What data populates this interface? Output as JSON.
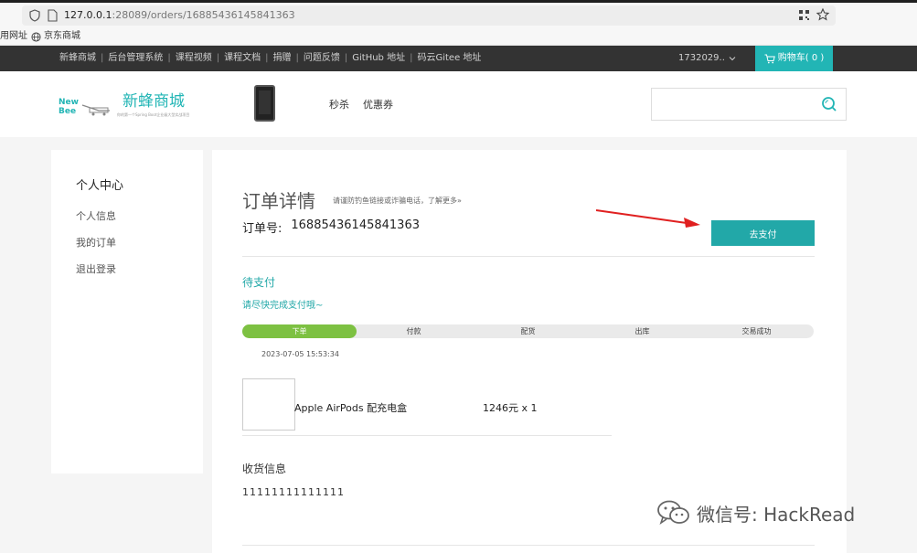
{
  "browser": {
    "url_host": "127.0.0.1",
    "url_rest": ":28089/orders/16885436145841363",
    "bookmarks": [
      "用网址",
      "京东商城"
    ]
  },
  "topnav": {
    "links": [
      "新蜂商城",
      "后台管理系统",
      "课程视频",
      "课程文档",
      "捐赠",
      "问题反馈",
      "GitHub 地址",
      "码云Gitee 地址"
    ],
    "user": "1732029..",
    "cart_label": "购物车( 0 )"
  },
  "header": {
    "logo_text": "New Bee",
    "site_name": "新蜂商城",
    "slogan": "你的第一个Spring Boot企业级大型实战项目",
    "promos": [
      "秒杀",
      "优惠券"
    ],
    "search_placeholder": ""
  },
  "sidebar": {
    "title": "个人中心",
    "items": [
      "个人信息",
      "我的订单",
      "退出登录"
    ]
  },
  "order": {
    "title": "订单详情",
    "hint": "请谨防钓鱼链接或诈骗电话，了解更多»",
    "no_label": "订单号:",
    "no_value": "16885436145841363",
    "pay_button": "去支付",
    "status": "待支付",
    "status_hint": "请尽快完成支付哦~",
    "steps": [
      "下单",
      "付款",
      "配货",
      "出库",
      "交易成功"
    ],
    "current_step": 1,
    "time": "2023-07-05 15:53:34",
    "product_name": "Apple AirPods 配充电盒",
    "product_price": "1246元 x 1",
    "shipping_title": "收货信息",
    "shipping_info": "11111111111111"
  },
  "watermark": "微信号: HackRead",
  "colors": {
    "accent": "#22b5b5",
    "progress": "#7dc142",
    "nav": "#333333"
  }
}
